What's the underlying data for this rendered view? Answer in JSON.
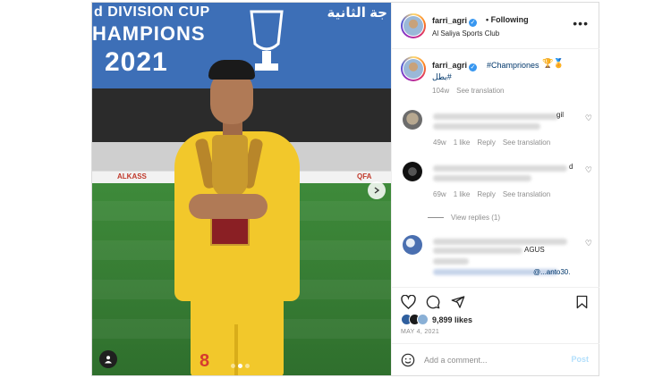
{
  "media": {
    "banner_line1": "d DIVISION CUP",
    "banner_line2": "HAMPIONS",
    "banner_line3": "2021",
    "banner_arabic": "جة الثانية",
    "board_text_1": "ALKASS",
    "board_text_2": "QFA",
    "shirt_number": "8",
    "carousel_dots": 3,
    "active_dot": 1
  },
  "header": {
    "username": "farri_agri",
    "follow_label": "• Following",
    "location": "Al Saliya Sports Club",
    "more_label": "•••"
  },
  "caption": {
    "username": "farri_agri",
    "hashtag": "#Champriones",
    "emoji1": "🏆",
    "emoji2": "🏅",
    "arabic_hashtag": "بطل#",
    "age": "104w",
    "see_translation": "See translation"
  },
  "comments": [
    {
      "age": "49w",
      "likes": "1 like",
      "reply": "Reply",
      "see_translation": "See translation",
      "partial_text": "gil"
    },
    {
      "age": "69w",
      "likes": "1 like",
      "reply": "Reply",
      "see_translation": "See translation",
      "partial_text": "d"
    },
    {
      "partial_text": "AGUS",
      "mention_text": "@...anto30."
    }
  ],
  "view_replies": "View replies (1)",
  "likes": "9,899 likes",
  "date": "MAY 4, 2021",
  "add_comment": {
    "placeholder": "Add a comment...",
    "post_label": "Post"
  },
  "colors": {
    "link": "#00376b",
    "verified": "#3897f0",
    "post_disabled": "#b2dffc",
    "jersey": "#f2c82b",
    "banner": "#3d6fb7"
  }
}
